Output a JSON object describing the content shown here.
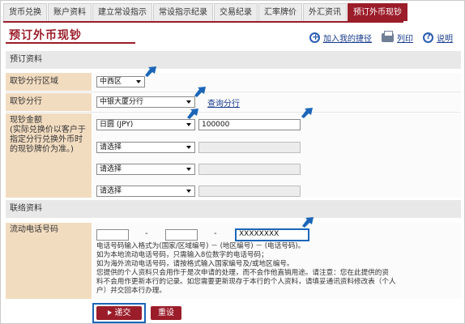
{
  "tabs": [
    {
      "label": "货币兑换"
    },
    {
      "label": "账户资料"
    },
    {
      "label": "建立常设指示"
    },
    {
      "label": "常设指示纪录"
    },
    {
      "label": "交易纪录"
    },
    {
      "label": "汇率牌价"
    },
    {
      "label": "外汇资讯"
    },
    {
      "label": "预订外币现钞",
      "active": true
    }
  ],
  "header": {
    "title": "预订外币现钞",
    "add_favorite": "加入我的捷径",
    "print": "列印",
    "help": "说明"
  },
  "booking": {
    "section_title": "预订资料",
    "district_label": "取钞分行区域",
    "district_value": "中西区",
    "branch_label": "取钞分行",
    "branch_value": "中银大厦分行",
    "branch_link": "查询分行",
    "amount_label": "现钞金额\n(实际兑换价以客户于指定分行兑换外币时的现钞牌价为准。)",
    "currencies": [
      {
        "currency": "日圆 (JPY)",
        "amount": "100000",
        "enabled": true
      },
      {
        "currency": "请选择",
        "amount": "",
        "enabled": false
      },
      {
        "currency": "请选择",
        "amount": "",
        "enabled": false
      },
      {
        "currency": "请选择",
        "amount": "",
        "enabled": false
      }
    ]
  },
  "contact": {
    "section_title": "联络资料",
    "mobile_label": "流动电话号码",
    "country_code": "",
    "area_code": "",
    "phone_number": "XXXXXXXX",
    "dash": "-",
    "notes": [
      "电话号码输入格式为(国家/区域编号) － (地区编号) － (电话号码)。",
      "如为本地流动电话号码，只需输入8位数字的电话号码；",
      "如为海外流动电话号码，请按格式输入国家编号及/或地区编号。",
      "您提供的个人资料只会用作于是次申请的处理，而不会作他直销用途。请注意：您在此提供的资",
      "料不会用作更新本行的记录。如您需要更新现存于本行的个人资料，请填妥通讯资料修改表（个人",
      "户）并交回本行办理。"
    ]
  },
  "actions": {
    "submit": "递交",
    "reset": "重设"
  },
  "colors": {
    "brand": "#9b1d2a",
    "label_bg": "#f2dcc0",
    "annotation_blue": "#1c66b8"
  }
}
